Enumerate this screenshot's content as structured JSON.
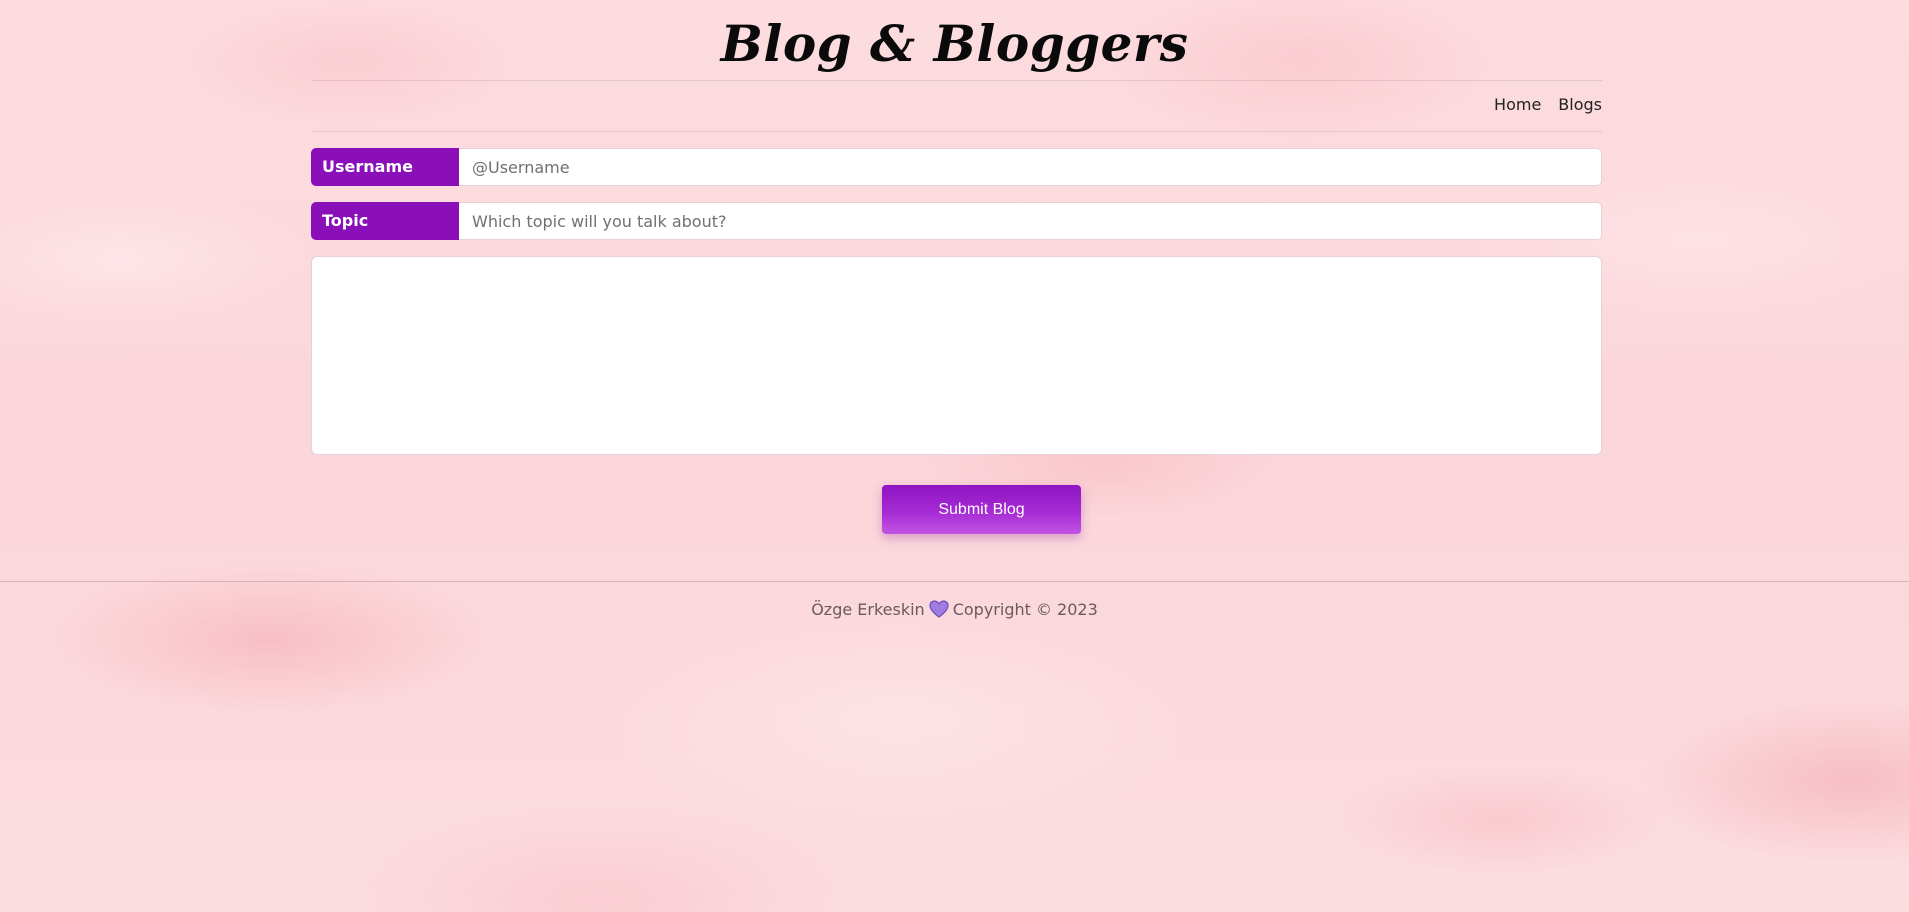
{
  "header": {
    "title": "Blog & Bloggers"
  },
  "nav": {
    "items": [
      {
        "label": "Home"
      },
      {
        "label": "Blogs"
      }
    ]
  },
  "form": {
    "username": {
      "label": "Username",
      "placeholder": "@Username",
      "value": ""
    },
    "topic": {
      "label": "Topic",
      "placeholder": "Which topic will you talk about?",
      "value": ""
    },
    "content": {
      "value": ""
    },
    "submit_label": "Submit Blog"
  },
  "footer": {
    "author": "Özge Erkeskin",
    "heart_icon": "purple-heart-icon",
    "copyright": "Copyright © 2023"
  },
  "colors": {
    "accent": "#8a0fb8",
    "background": "#fbd9dc",
    "heart": "#9b6fd8"
  }
}
